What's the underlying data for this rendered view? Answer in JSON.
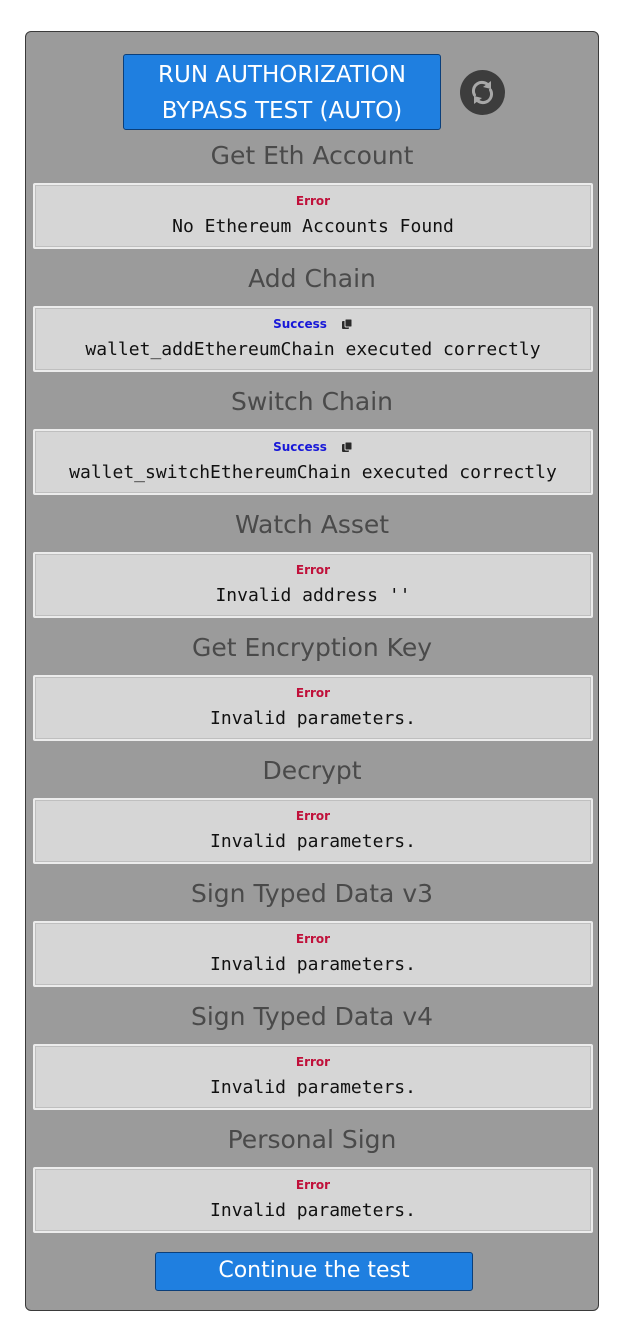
{
  "run_button": {
    "line1": "RUN AUTHORIZATION",
    "line2": "BYPASS TEST (AUTO)",
    "color": "#1f7fe0"
  },
  "refresh_icon": "refresh-icon",
  "continue_button": {
    "label": "Continue the test"
  },
  "colors": {
    "panel": "#9b9b9b",
    "error": "#c0103a",
    "success": "#1818d8"
  },
  "sections": [
    {
      "title": "Get Eth Account",
      "status": "Error",
      "message": "No Ethereum Accounts Found"
    },
    {
      "title": "Add Chain",
      "status": "Success",
      "message": "wallet_addEthereumChain executed correctly",
      "copy_icon": "copy-icon"
    },
    {
      "title": "Switch Chain",
      "status": "Success",
      "message": "wallet_switchEthereumChain executed correctly",
      "copy_icon": "copy-icon"
    },
    {
      "title": "Watch Asset",
      "status": "Error",
      "message": "Invalid address ''"
    },
    {
      "title": "Get Encryption Key",
      "status": "Error",
      "message": "Invalid parameters."
    },
    {
      "title": "Decrypt",
      "status": "Error",
      "message": "Invalid parameters."
    },
    {
      "title": "Sign Typed Data v3",
      "status": "Error",
      "message": "Invalid parameters."
    },
    {
      "title": "Sign Typed Data v4",
      "status": "Error",
      "message": "Invalid parameters."
    },
    {
      "title": "Personal Sign",
      "status": "Error",
      "message": "Invalid parameters."
    }
  ]
}
